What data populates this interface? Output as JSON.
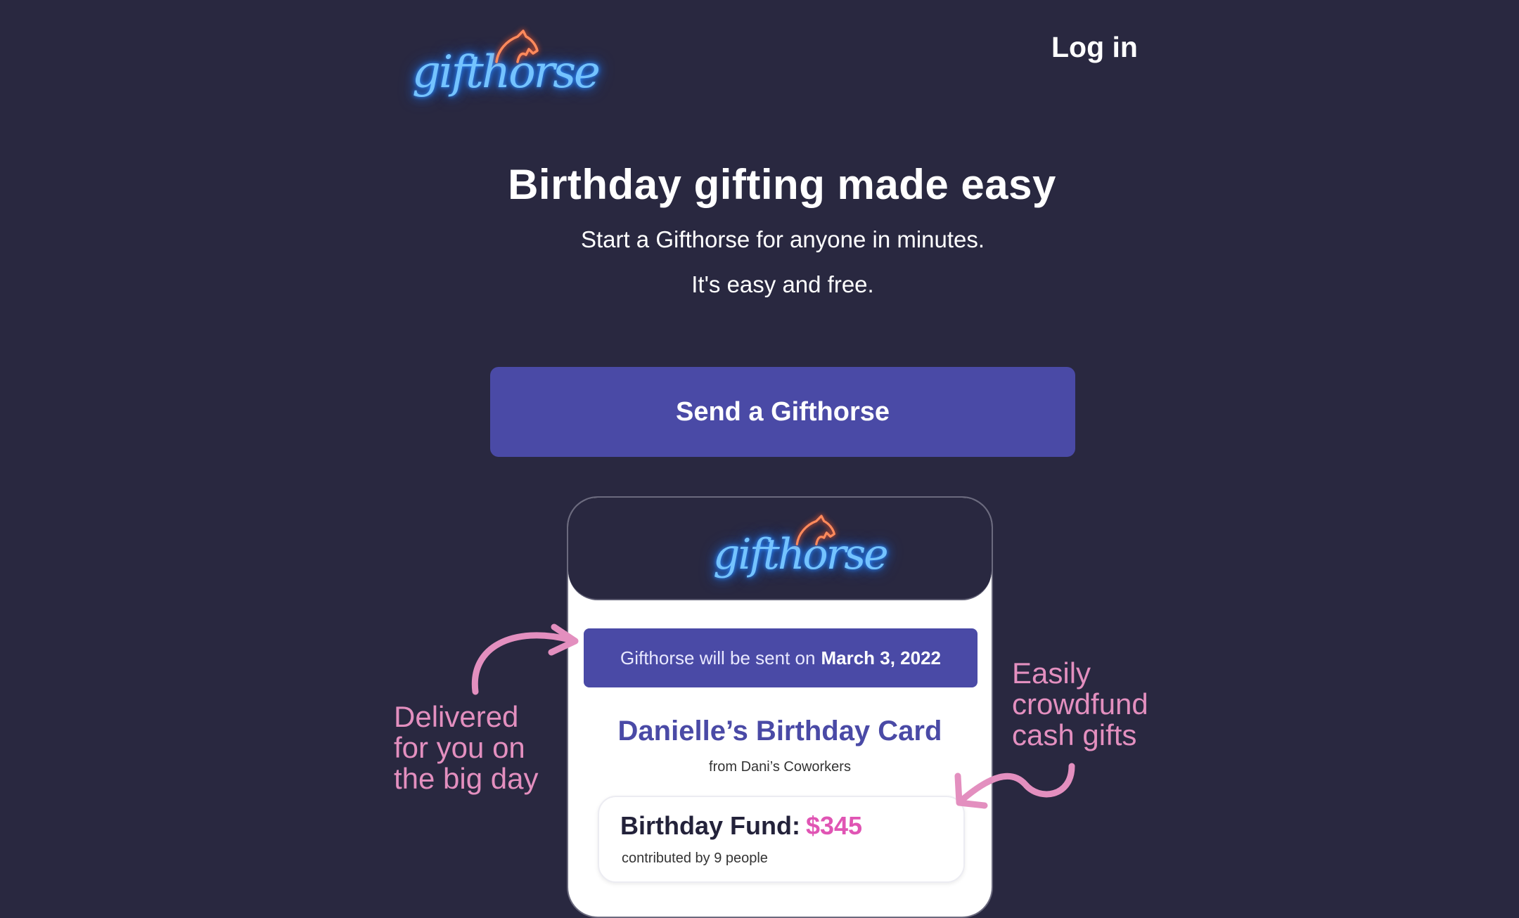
{
  "brand": {
    "logo_text": "gifthorse",
    "logo_color": "#74c3ff",
    "horse_color": "#ff8a5c"
  },
  "header": {
    "login_label": "Log in"
  },
  "hero": {
    "title": "Birthday gifting made easy",
    "subtitle_line1": "Start a Gifthorse for anyone in minutes.",
    "subtitle_line2": "It's easy and free.",
    "cta_label": "Send a Gifthorse"
  },
  "preview": {
    "banner_prefix": "Gifthorse will be sent on",
    "banner_date": "March 3, 2022",
    "card_title": "Danielle’s Birthday Card",
    "card_from": "from Dani’s Coworkers",
    "fund_label": "Birthday Fund:",
    "fund_amount": "$345",
    "fund_contributors": "contributed by 9 people"
  },
  "annotations": {
    "left": [
      "Delivered",
      "for you on",
      "the big day"
    ],
    "right": [
      "Easily",
      "crowdfund",
      "cash gifts"
    ]
  },
  "colors": {
    "background": "#292840",
    "accent": "#4a4aa6",
    "annotation": "#e38fbf",
    "fund_amount": "#e055b4"
  }
}
